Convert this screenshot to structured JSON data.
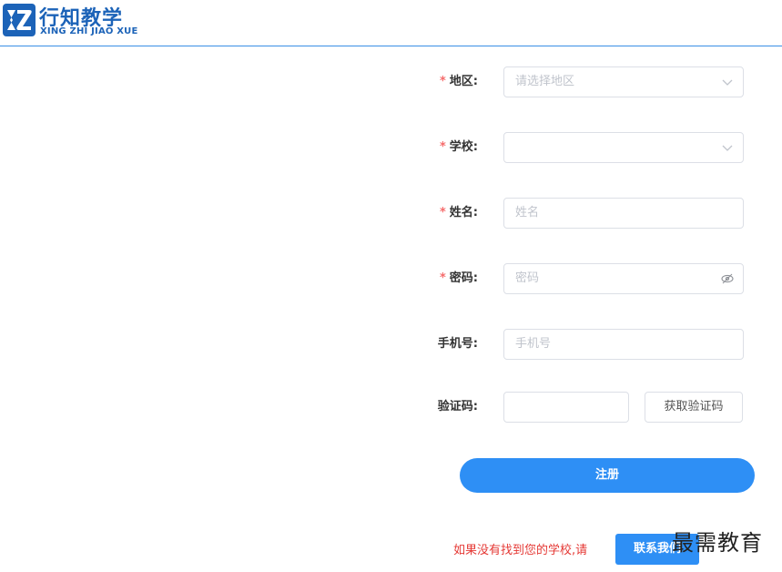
{
  "header": {
    "brand_name": "行知教学",
    "brand_subtitle": "XING ZHI JIAO XUE"
  },
  "form": {
    "region": {
      "label": "地区:",
      "required": true,
      "placeholder": "请选择地区",
      "icon": "chevron-down-icon"
    },
    "school": {
      "label": "学校:",
      "required": true,
      "placeholder": "",
      "icon": "chevron-down-icon"
    },
    "name": {
      "label": "姓名:",
      "required": true,
      "placeholder": "姓名"
    },
    "password": {
      "label": "密码:",
      "required": true,
      "placeholder": "密码",
      "icon": "eye-off-icon"
    },
    "phone": {
      "label": "手机号:",
      "required": false,
      "placeholder": "手机号"
    },
    "code": {
      "label": "验证码:",
      "required": false,
      "placeholder": "",
      "button_label": "获取验证码"
    },
    "required_mark": "*"
  },
  "actions": {
    "submit_label": "注册",
    "notice": "如果没有找到您的学校,请",
    "contact_label": "联系我们"
  },
  "watermark": "最需教育",
  "colors": {
    "primary": "#2e8ff5",
    "brand": "#1c63b8",
    "required": "#f56c6c",
    "notice": "#e53935"
  }
}
